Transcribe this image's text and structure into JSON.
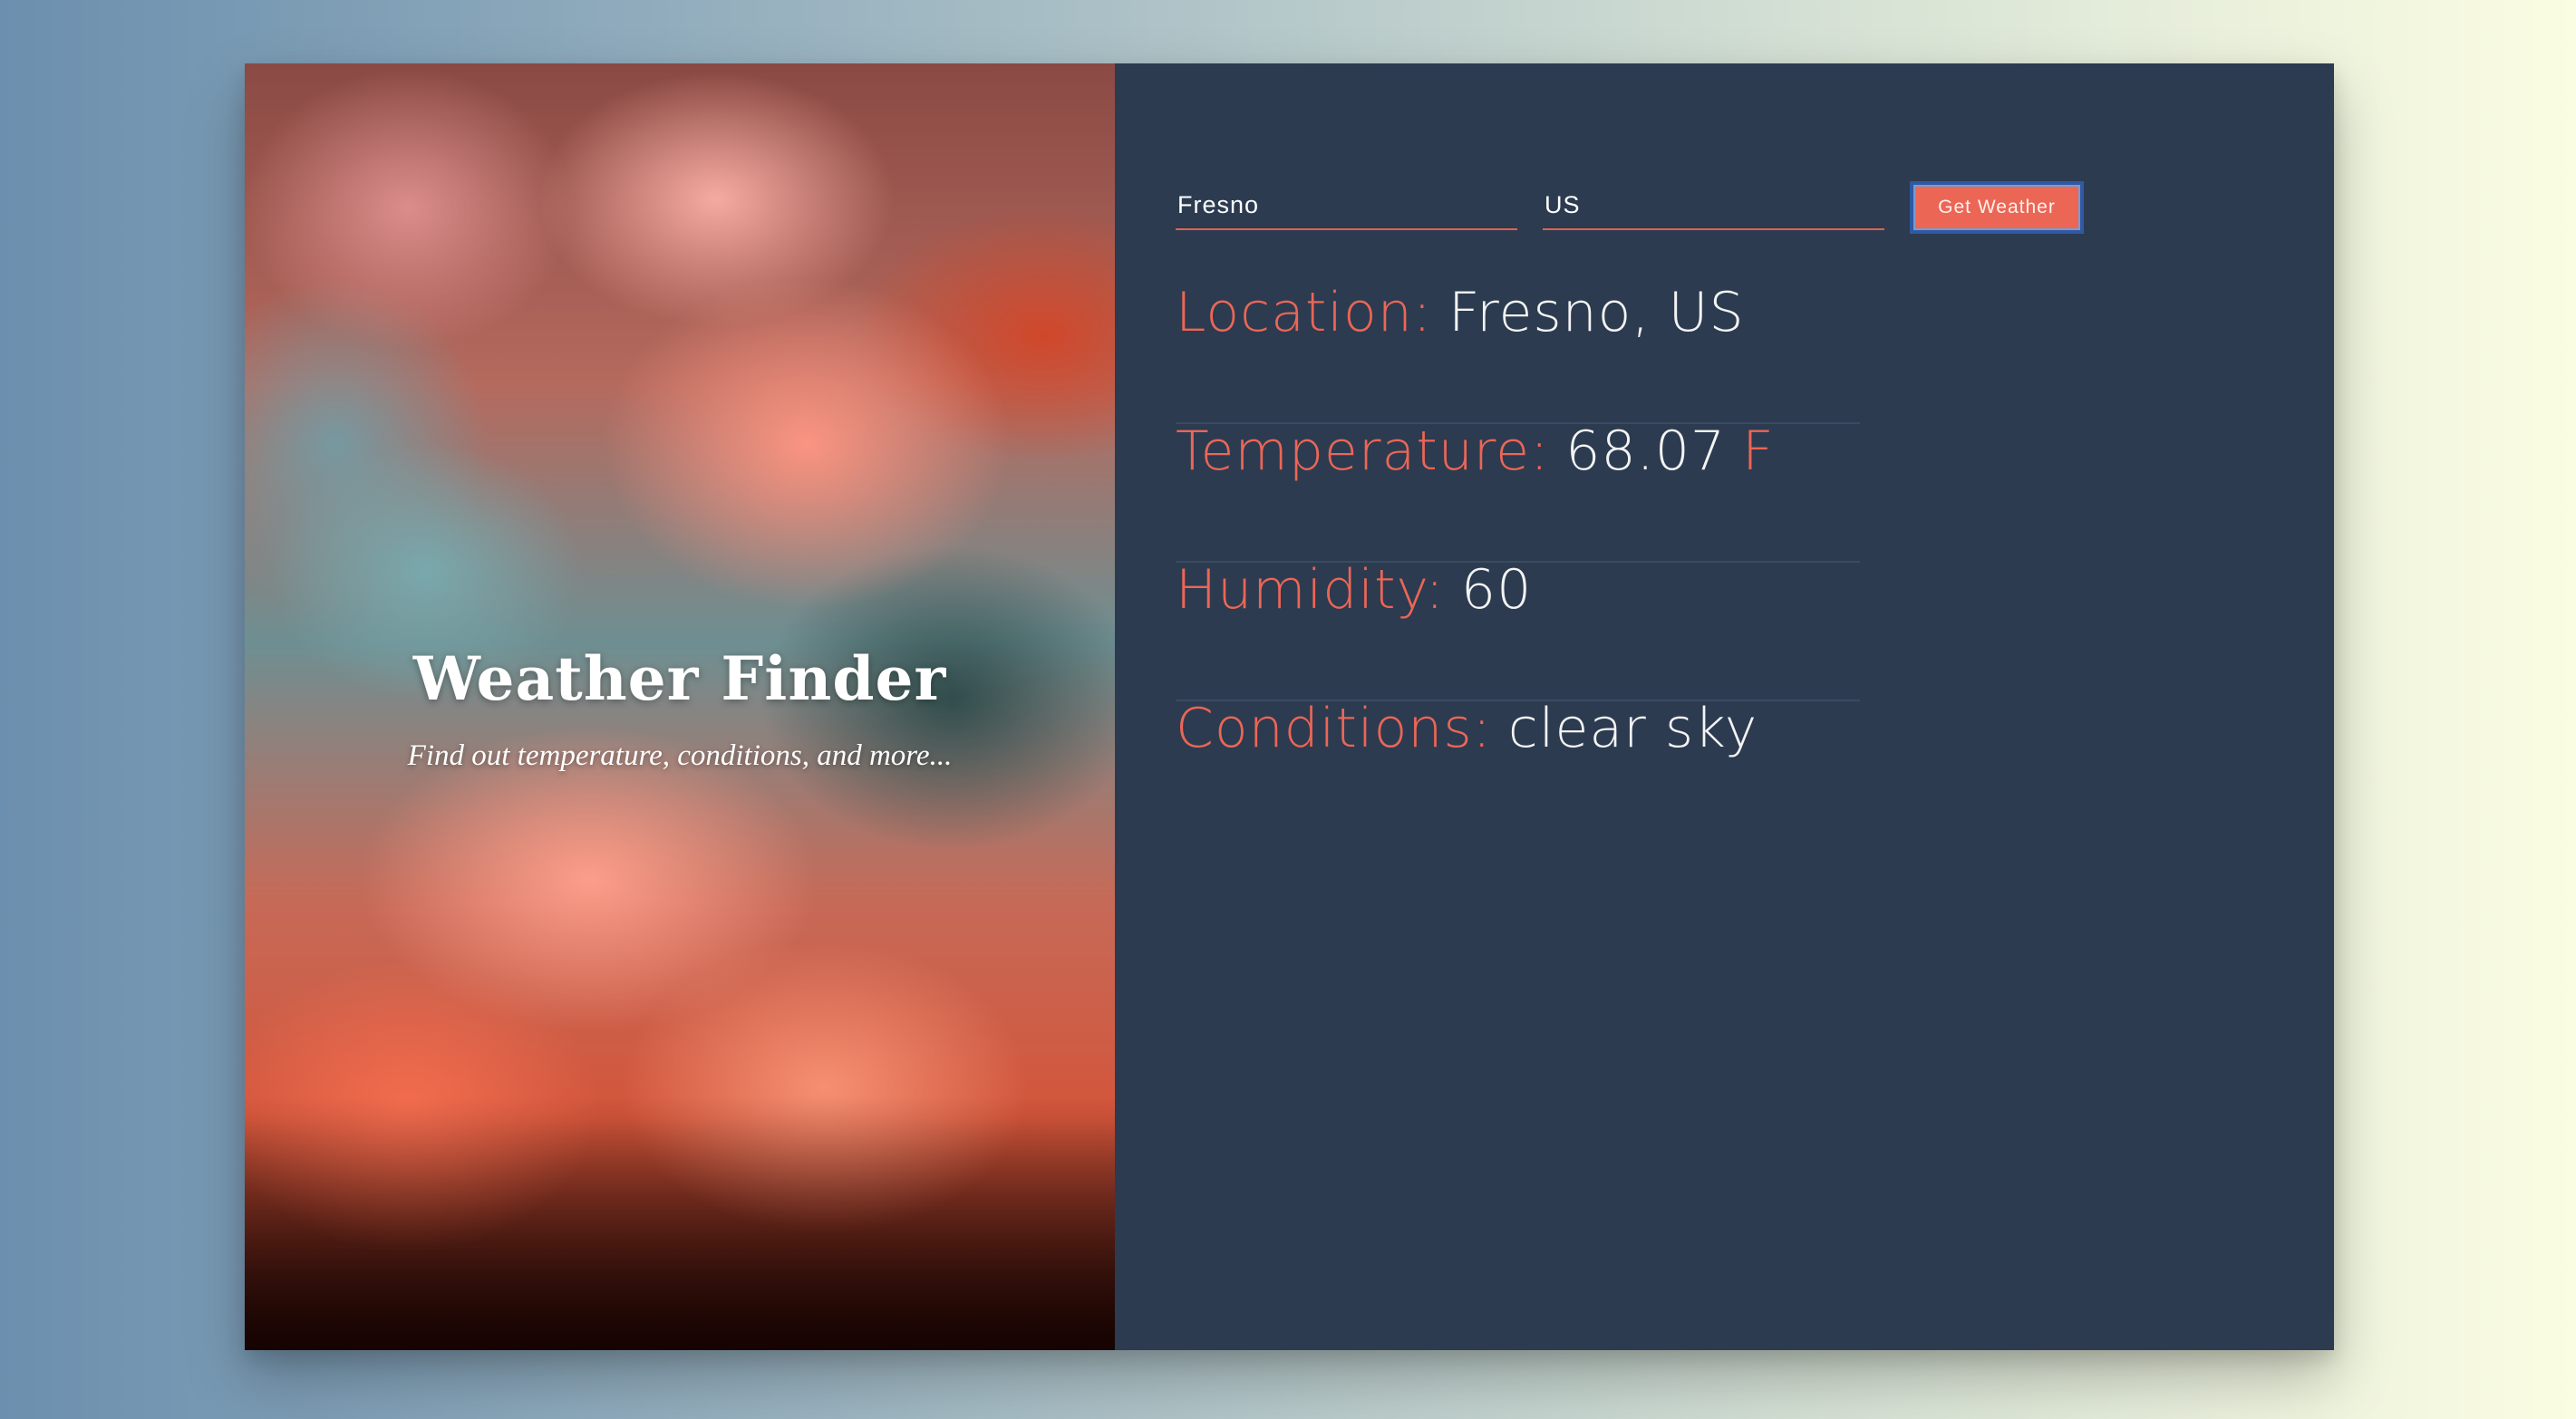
{
  "hero": {
    "title": "Weather Finder",
    "subtitle": "Find out temperature, conditions, and more..."
  },
  "form": {
    "city_value": "Fresno",
    "country_value": "US",
    "submit_label": "Get Weather"
  },
  "results": {
    "location_label": "Location:",
    "location_value": "Fresno, US",
    "temperature_label": "Temperature:",
    "temperature_value": "68.07",
    "temperature_unit": "F",
    "humidity_label": "Humidity:",
    "humidity_value": "60",
    "conditions_label": "Conditions:",
    "conditions_value": "clear sky"
  },
  "colors": {
    "accent": "#ec6656",
    "panel_bg": "#2c3b50",
    "text": "#f3f3f3",
    "button_focus_border": "#2f5aa3"
  }
}
